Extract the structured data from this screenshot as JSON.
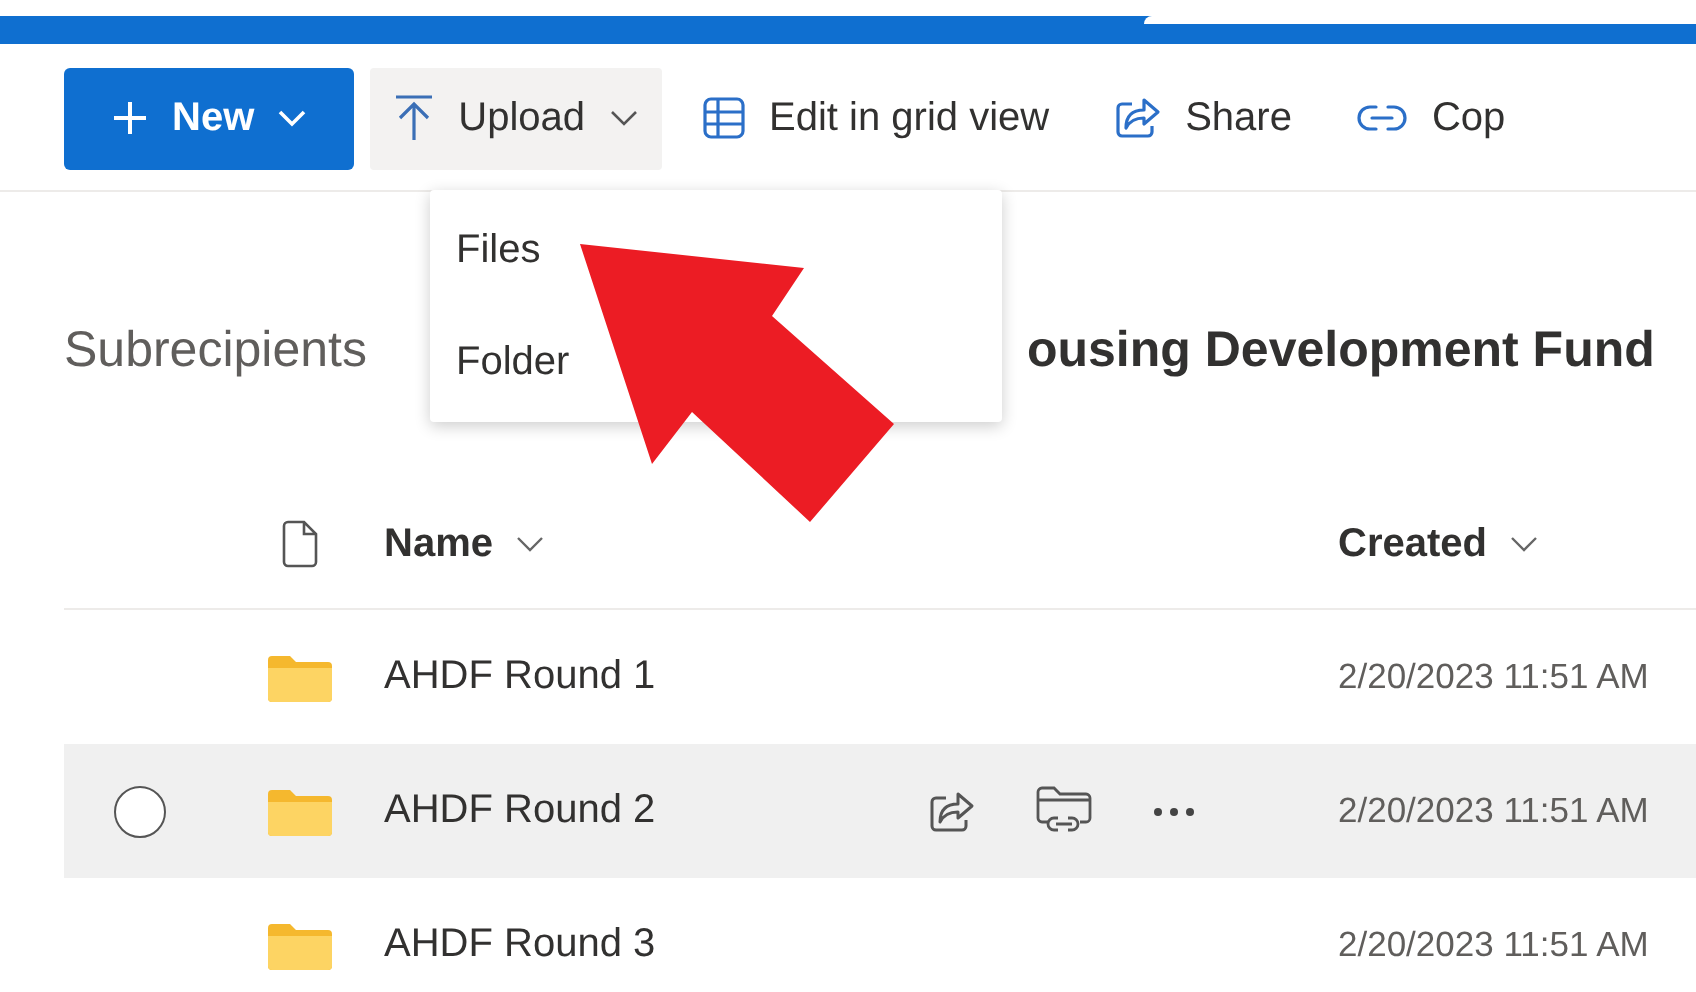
{
  "toolbar": {
    "new_button": {
      "label": "New"
    },
    "upload_button": {
      "label": "Upload",
      "selected": true
    },
    "items": [
      {
        "kind": "grid",
        "label": "Edit in grid view"
      },
      {
        "kind": "share",
        "label": "Share"
      },
      {
        "kind": "link",
        "label": "Cop"
      }
    ]
  },
  "upload_menu": {
    "items": [
      "Files",
      "Folder"
    ]
  },
  "breadcrumb": {
    "parent": "Subrecipients",
    "current": "ousing Development Fund"
  },
  "table": {
    "columns": [
      {
        "label": "Name"
      },
      {
        "label": "Created"
      }
    ],
    "rows": [
      {
        "name": "AHDF Round 1",
        "created": "2/20/2023 11:51 AM",
        "selected": false
      },
      {
        "name": "AHDF Round 2",
        "created": "2/20/2023 11:51 AM",
        "selected": true
      },
      {
        "name": "AHDF Round 3",
        "created": "2/20/2023 11:51 AM",
        "selected": false
      }
    ]
  }
}
